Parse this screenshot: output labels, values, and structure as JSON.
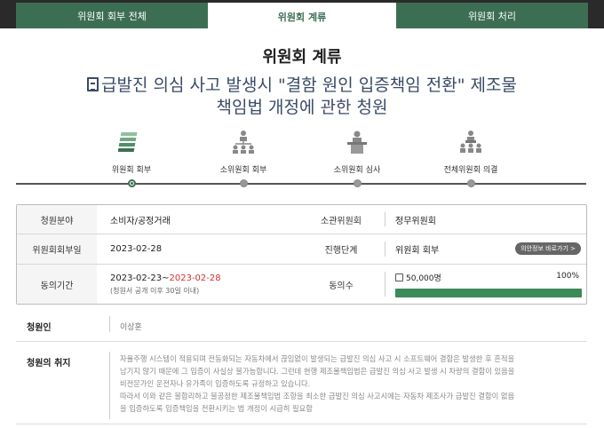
{
  "tabs": [
    {
      "label": "위원회 회부 전체"
    },
    {
      "label": "위원회 계류"
    },
    {
      "label": "위원회 처리"
    }
  ],
  "page_title": "위원회 계류",
  "petition_title_line1": "급발진 의심 사고 발생시 \"결함 원인 입증책임 전환\" 제조물",
  "petition_title_line2": "책임법 개정에 관한 청원",
  "steps": [
    {
      "label": "위원회 회부",
      "icon": "documents-stack-icon",
      "active": true
    },
    {
      "label": "소위원회 회부",
      "icon": "org-chart-icon",
      "active": false
    },
    {
      "label": "소위원회 심사",
      "icon": "podium-icon",
      "active": false
    },
    {
      "label": "전체위원회 의결",
      "icon": "assembly-icon",
      "active": false
    }
  ],
  "info": {
    "field_label": "청원분야",
    "field_value": "소비자/공정거래",
    "committee_label": "소관위원회",
    "committee_value": "정무위원회",
    "referral_date_label": "위원회회부일",
    "referral_date_value": "2023-02-28",
    "stage_label": "진행단계",
    "stage_value": "위원회 회부",
    "bill_info_button": "의안정보 바로가기 >",
    "period_label": "동의기간",
    "period_start": "2023-02-23~",
    "period_end": "2023-02-28",
    "period_note": "(청원서 공개 이후 30일 이내)",
    "agree_label": "동의수",
    "agree_count": "50,000명",
    "agree_percent": "100%",
    "agree_fraction": 1.0
  },
  "petitioner_label": "청원인",
  "petitioner_value": "이상훈",
  "purpose_label": "청원의 취지",
  "purpose_text": "자율주행 시스템이 적용되며 전동화되는 자동차에서 끊임없이 발생되는 급발진 의심 사고 시 소프트웨어 결함은 발생한 후 흔적을\n남기지 않기 때문에 그 입증이 사실상 불가능합니다. 그런데 현행 제조물책임법은 급발진 의심 사고 발생 시 차량의 결함이 있음을\n비전문가인 운전자나 유가족이 입증하도록 규정하고 있습니다.\n따라서 이와 같은 불합리하고 불공정한 제조물책임법 조항을 최소한 급발진 의심 사고시에는 자동차 제조사가 급발진 결함이 없음\n을 입증하도록 입증책임을 전환시키는 법 개정이 시급히 필요함",
  "colors": {
    "accent": "#3c6e54",
    "title": "#3b4a66",
    "date_red": "#d0312d",
    "bar": "#3c8a5a"
  }
}
